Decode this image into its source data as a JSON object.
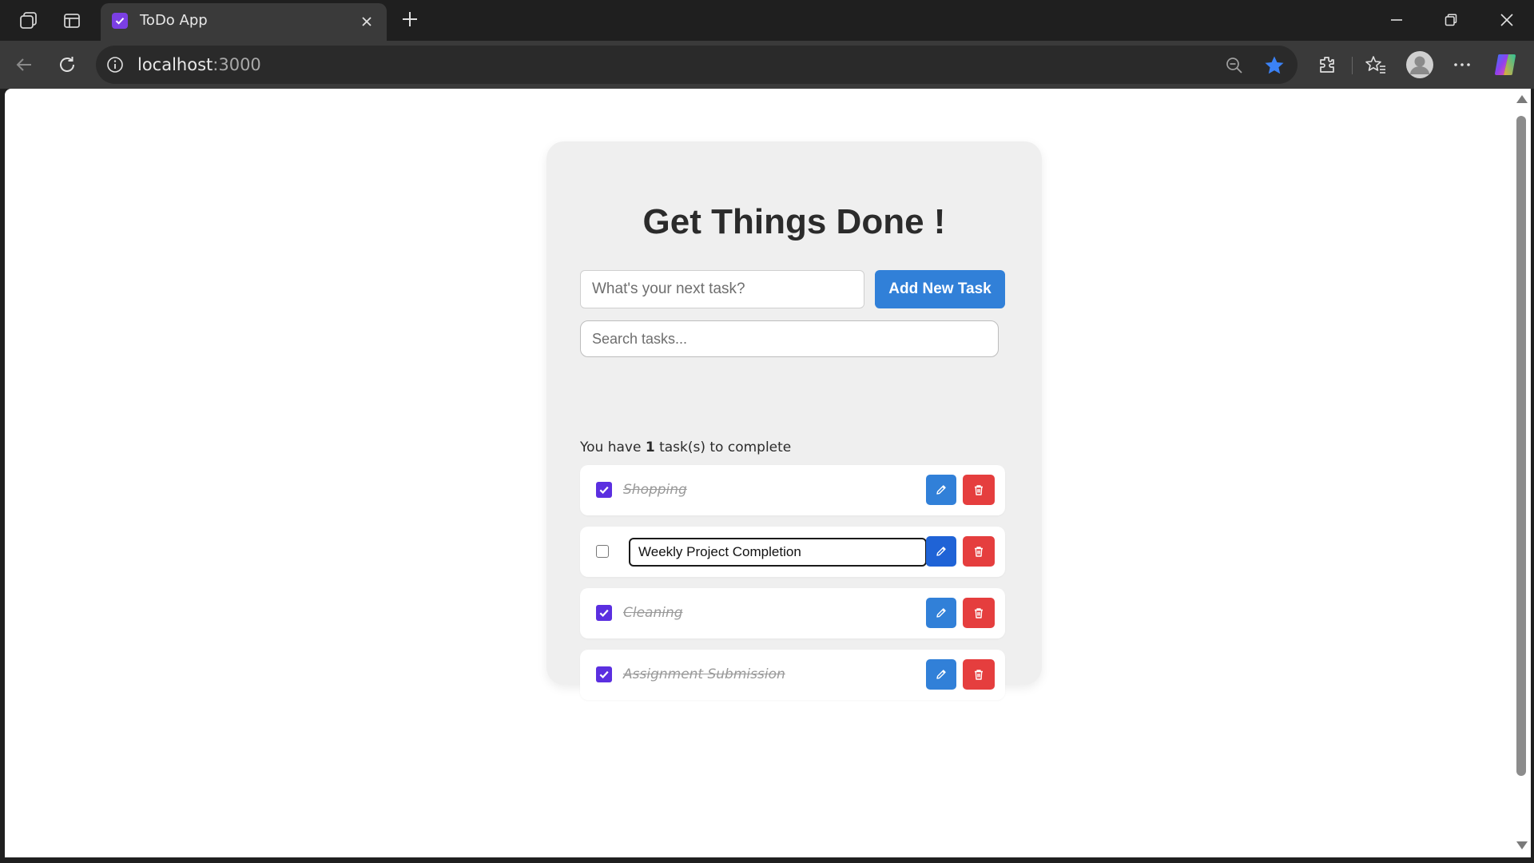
{
  "browser": {
    "tab_title": "ToDo App",
    "url_host": "localhost",
    "url_port": ":3000",
    "icons": [
      "workspaces-icon",
      "tab-actions-icon",
      "todo-favicon",
      "close-icon",
      "plus-icon",
      "minimize-icon",
      "restore-icon",
      "close-window-icon",
      "back-arrow-icon",
      "refresh-icon",
      "info-icon",
      "zoom-out-icon",
      "star-icon",
      "extensions-icon",
      "favorites-icon",
      "profile-icon",
      "more-icon",
      "copilot-icon"
    ],
    "colors": {
      "titlebar": "#1f1f1f",
      "toolbar": "#3a3a3a",
      "favorite_star": "#3b82f6"
    }
  },
  "app": {
    "title": "Get Things Done !",
    "new_task_placeholder": "What's your next task?",
    "add_button_label": "Add New Task",
    "search_placeholder": "Search tasks...",
    "count_prefix": "You have ",
    "count_value": "1",
    "count_suffix": " task(s) to complete",
    "tasks": [
      {
        "text": "Shopping",
        "completed": true,
        "editing": false
      },
      {
        "text": "Weekly Project Completion",
        "completed": false,
        "editing": true
      },
      {
        "text": "Cleaning",
        "completed": true,
        "editing": false
      },
      {
        "text": "Assignment Submission",
        "completed": true,
        "editing": false
      }
    ],
    "icons": [
      "checkmark-icon",
      "pencil-icon",
      "trash-icon"
    ],
    "colors": {
      "primary_button": "#3180d8",
      "delete_button": "#e53e3e",
      "checkbox": "#5b2fe0",
      "card_background": "#efefef"
    }
  }
}
